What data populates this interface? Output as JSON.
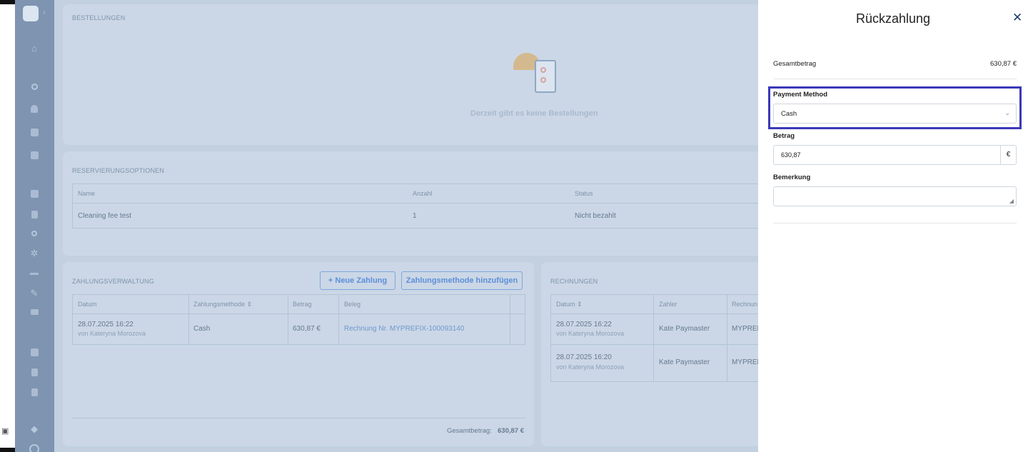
{
  "drawer": {
    "title": "Rückzahlung",
    "total_label": "Gesamtbetrag",
    "total_value": "630,87 €",
    "payment_method_label": "Payment Method",
    "payment_method_value": "Cash",
    "amount_label": "Betrag",
    "amount_value": "630,87",
    "amount_currency": "€",
    "note_label": "Bemerkung",
    "note_value": ""
  },
  "orders": {
    "title": "BESTELLUNGEN",
    "empty_text": "Derzeit gibt es keine Bestellungen"
  },
  "reservation_options": {
    "title": "RESERVIERUNGSOPTIONEN",
    "columns": [
      "Name",
      "Anzahl",
      "Status"
    ],
    "rows": [
      {
        "name": "Cleaning fee test",
        "count": "1",
        "status": "Nicht bezahlt"
      }
    ]
  },
  "payments": {
    "title": "ZAHLUNGSVERWALTUNG",
    "new_payment_label": "+ Neue Zahlung",
    "add_method_label": "Zahlungsmethode hinzufügen",
    "columns": [
      "Datum",
      "Zahlungsmethode",
      "Betrag",
      "Beleg"
    ],
    "rows": [
      {
        "date": "28.07.2025 16:22",
        "by": "von Kateryna Morozova",
        "method": "Cash",
        "amount": "630,87 €",
        "receipt": "Rechnung Nr. MYPREFIX-100093140"
      }
    ],
    "total_label": "Gesamtbetrag:",
    "total_value": "630,87 €"
  },
  "invoices": {
    "title": "RECHNUNGEN",
    "columns": [
      "Datum",
      "Zahler",
      "Rechnun"
    ],
    "rows": [
      {
        "date": "28.07.2025 16:22",
        "by": "von Kateryna Morozova",
        "payer": "Kate Paymaster",
        "number": "MYPREF"
      },
      {
        "date": "28.07.2025 16:20",
        "by": "von Kateryna Morozova",
        "payer": "Kate Paymaster",
        "number": "MYPREF"
      }
    ]
  },
  "colors": {
    "highlight": "#3b38b8",
    "sidebar": "#7e94b0",
    "overlay": "#c2d0e0"
  }
}
